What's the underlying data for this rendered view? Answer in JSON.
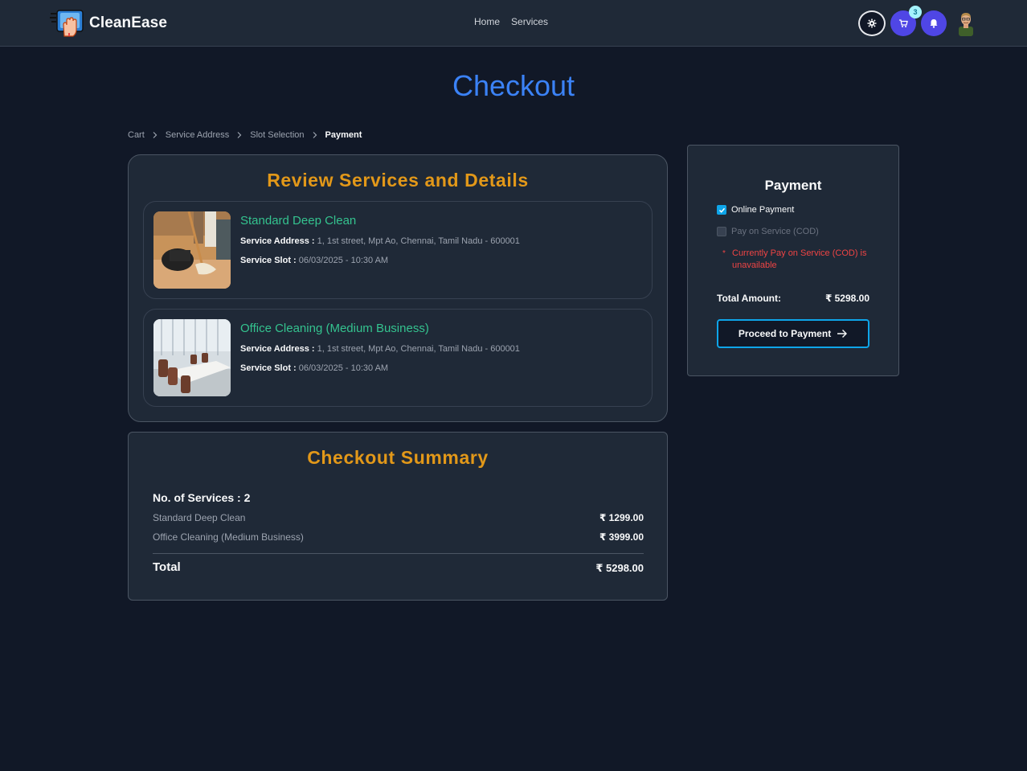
{
  "app": {
    "brand_name": "CleanEase"
  },
  "nav": {
    "links": [
      "Home",
      "Services"
    ],
    "cart_count": "3"
  },
  "page": {
    "title": "Checkout"
  },
  "breadcrumb": [
    "Cart",
    "Service Address",
    "Slot Selection",
    "Payment"
  ],
  "review": {
    "title": "Review Services and Details",
    "address_label": "Service Address :",
    "slot_label": "Service Slot :",
    "items": [
      {
        "name": "Standard Deep Clean",
        "address": "1, 1st street, Mpt Ao, Chennai, Tamil Nadu - 600001",
        "slot": "06/03/2025 - 10:30 AM",
        "image": "floor-mopping-photo"
      },
      {
        "name": "Office Cleaning (Medium Business)",
        "address": "1, 1st street, Mpt Ao, Chennai, Tamil Nadu - 600001",
        "slot": "06/03/2025 - 10:30 AM",
        "image": "conference-room-photo"
      }
    ]
  },
  "summary": {
    "title": "Checkout Summary",
    "count_text": "No. of Services : 2",
    "rows": [
      {
        "name": "Standard Deep Clean",
        "price": "₹ 1299.00"
      },
      {
        "name": "Office Cleaning (Medium Business)",
        "price": "₹ 3999.00"
      }
    ],
    "total_label": "Total",
    "total_value": "₹ 5298.00"
  },
  "payment": {
    "title": "Payment",
    "options": [
      {
        "label": "Online Payment",
        "checked": true
      },
      {
        "label": "Pay on Service (COD)",
        "checked": false
      }
    ],
    "warning_star": "*",
    "warning": "Currently Pay on Service (COD) is unavailable",
    "total_label": "Total Amount:",
    "total_value": "₹ 5298.00",
    "button_label": "Proceed to Payment"
  },
  "colors": {
    "background": "#111827",
    "card": "#1f2937",
    "accent_blue": "#3b82f6",
    "section_orange": "#e29819",
    "service_green": "#34c38f",
    "warning_red": "#ef4444",
    "button_border": "#0ea5e9"
  },
  "icons": [
    "cleaning-hand-logo",
    "gear-icon",
    "cart-icon",
    "bell-icon",
    "user-avatar",
    "chevron-right-icon",
    "checkmark-icon",
    "arrow-right-icon"
  ]
}
